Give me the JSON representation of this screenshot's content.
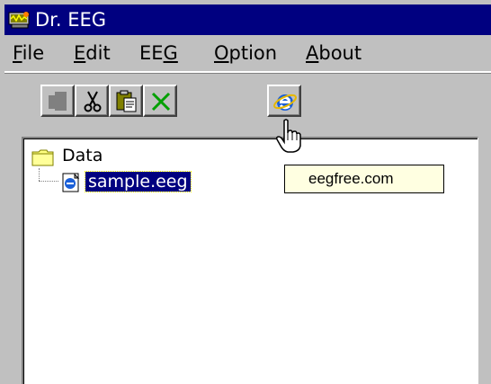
{
  "window": {
    "title": "Dr. EEG",
    "accent": "#000080"
  },
  "menu": [
    {
      "label": "File",
      "mnemonic_index": 0
    },
    {
      "label": "Edit",
      "mnemonic_index": 0
    },
    {
      "label": "EEG",
      "mnemonic_index": 2
    },
    {
      "label": "Option",
      "mnemonic_index": 0
    },
    {
      "label": "About",
      "mnemonic_index": 0
    }
  ],
  "toolbar": {
    "buttons": [
      {
        "name": "copy-button",
        "icon": "copy-icon",
        "enabled": false
      },
      {
        "name": "cut-button",
        "icon": "scissors-icon",
        "enabled": true
      },
      {
        "name": "paste-button",
        "icon": "clipboard-icon",
        "enabled": true
      },
      {
        "name": "delete-button",
        "icon": "x-icon",
        "enabled": true
      },
      {
        "name": "web-button",
        "icon": "internet-explorer-icon",
        "enabled": true
      }
    ]
  },
  "tree": {
    "root": {
      "label": "Data",
      "icon": "folder-icon"
    },
    "children": [
      {
        "label": "sample.eeg",
        "icon": "eeg-file-icon",
        "selected": true
      }
    ]
  },
  "tooltip": {
    "text": "eegfree.com"
  },
  "cursor": {
    "icon": "hand-pointer-icon"
  }
}
